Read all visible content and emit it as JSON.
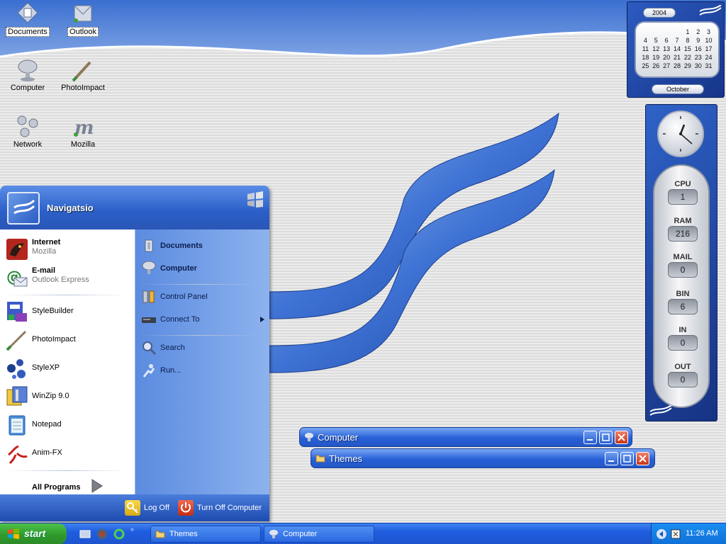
{
  "desktop": {
    "icons": [
      {
        "label": "Documents",
        "icon": "documents-icon"
      },
      {
        "label": "Outlook",
        "icon": "outlook-icon"
      },
      {
        "label": "Computer",
        "icon": "computer-icon"
      },
      {
        "label": "PhotoImpact",
        "icon": "photoimpact-icon"
      },
      {
        "label": "Network",
        "icon": "network-icon"
      },
      {
        "label": "Mozilla",
        "icon": "mozilla-icon"
      }
    ]
  },
  "calendar": {
    "year": "2004",
    "month": "October",
    "days": [
      "",
      "",
      "",
      "",
      "1",
      "2",
      "3",
      "4",
      "5",
      "6",
      "7",
      "8",
      "9",
      "10",
      "11",
      "12",
      "13",
      "14",
      "15",
      "16",
      "17",
      "18",
      "19",
      "20",
      "21",
      "22",
      "23",
      "24",
      "25",
      "26",
      "27",
      "28",
      "29",
      "30",
      "31"
    ]
  },
  "monitor": {
    "meters": [
      {
        "name": "CPU",
        "value": "1"
      },
      {
        "name": "RAM",
        "value": "216"
      },
      {
        "name": "MAIL",
        "value": "0"
      },
      {
        "name": "BIN",
        "value": "6"
      },
      {
        "name": "IN",
        "value": "0"
      },
      {
        "name": "OUT",
        "value": "0"
      }
    ]
  },
  "start_menu": {
    "user_name": "Navigatsio",
    "pinned": [
      {
        "title": "Internet",
        "subtitle": "Mozilla",
        "icon": "mozilla-icon"
      },
      {
        "title": "E-mail",
        "subtitle": "Outlook Express",
        "icon": "email-icon"
      }
    ],
    "recent": [
      {
        "label": "StyleBuilder",
        "icon": "stylebuilder-icon"
      },
      {
        "label": "PhotoImpact",
        "icon": "photoimpact-icon"
      },
      {
        "label": "StyleXP",
        "icon": "stylexp-icon"
      },
      {
        "label": "WinZip 9.0",
        "icon": "winzip-icon"
      },
      {
        "label": "Notepad",
        "icon": "notepad-icon"
      },
      {
        "label": "Anim-FX",
        "icon": "animfx-icon"
      }
    ],
    "all_programs": "All Programs",
    "right": [
      {
        "label": "Documents",
        "bold": true,
        "icon": "documents-icon"
      },
      {
        "label": "Computer",
        "bold": true,
        "icon": "computer-icon"
      },
      {
        "label": "Control Panel",
        "bold": false,
        "icon": "control-panel-icon"
      },
      {
        "label": "Connect To",
        "bold": false,
        "icon": "connect-to-icon"
      },
      {
        "label": "Search",
        "bold": false,
        "icon": "search-icon"
      },
      {
        "label": "Run...",
        "bold": false,
        "icon": "run-icon"
      }
    ],
    "log_off": "Log Off",
    "turn_off": "Turn Off Computer"
  },
  "windows": [
    {
      "title": "Computer"
    },
    {
      "title": "Themes"
    }
  ],
  "taskbar": {
    "start_label": "start",
    "tasks": [
      {
        "label": "Themes"
      },
      {
        "label": "Computer"
      }
    ],
    "clock": "11:26 AM"
  },
  "colors": {
    "accent": "#2a5fd0",
    "start_green": "#2f9a2c",
    "close_red": "#c93416"
  }
}
